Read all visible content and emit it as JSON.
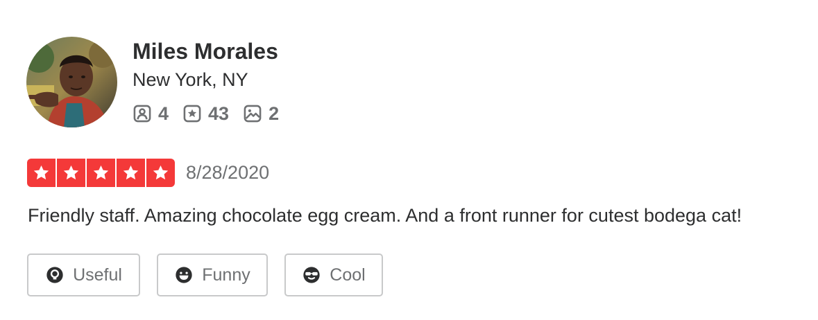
{
  "user": {
    "name": "Miles Morales",
    "location": "New York, NY",
    "stats": {
      "friends": "4",
      "reviews": "43",
      "photos": "2"
    }
  },
  "review": {
    "rating": 5,
    "max_rating": 5,
    "date": "8/28/2020",
    "text": "Friendly staff. Amazing chocolate egg cream. And a front runner for cutest bodega cat!"
  },
  "reactions": {
    "useful_label": "Useful",
    "funny_label": "Funny",
    "cool_label": "Cool"
  },
  "colors": {
    "star_red": "#f43939",
    "text_dark": "#2d2e2f",
    "text_gray": "#6e7072",
    "border_gray": "#c8c9ca"
  },
  "icons": {
    "friends": "user-friends-icon",
    "reviews": "review-star-icon",
    "photos": "photo-icon",
    "useful": "useful-lightbulb-icon",
    "funny": "funny-smile-icon",
    "cool": "cool-sunglasses-icon"
  }
}
